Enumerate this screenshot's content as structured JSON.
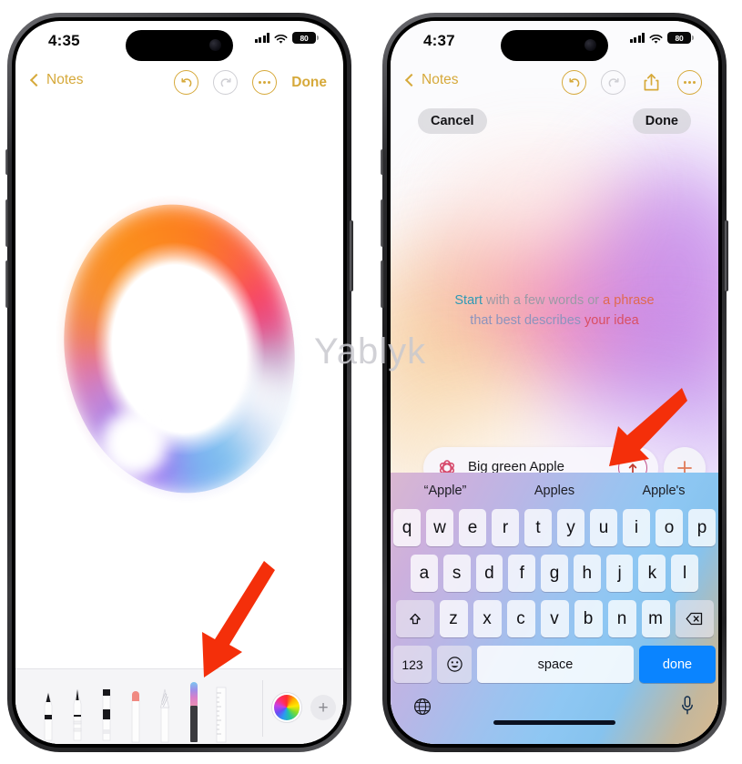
{
  "watermark": "Yablyk",
  "phones": {
    "left": {
      "status": {
        "time": "4:35",
        "battery": "80",
        "signal_icon": "cellular-bars-icon",
        "wifi_icon": "wifi-icon"
      },
      "nav": {
        "back_label": "Notes",
        "back_icon": "chevron-left-icon",
        "undo_icon": "undo-icon",
        "redo_icon": "redo-icon",
        "more_icon": "ellipsis-circle-icon",
        "done_label": "Done"
      },
      "canvas": {
        "drawing": "rainbow-circle-sketch"
      },
      "palette": {
        "tools": [
          {
            "name": "pen-tool",
            "label": "Pen"
          },
          {
            "name": "fountain-pen-tool",
            "label": "Fountain pen"
          },
          {
            "name": "marker-tool",
            "label": "Marker"
          },
          {
            "name": "pencil-tool",
            "label": "Pencil"
          },
          {
            "name": "brush-tool",
            "label": "Brush"
          },
          {
            "name": "image-wand-tool",
            "label": "Image Wand"
          },
          {
            "name": "ruler-tool",
            "label": "Ruler"
          }
        ],
        "color_wheel": "color-wheel-icon",
        "add_label": "+"
      }
    },
    "right": {
      "status": {
        "time": "4:37",
        "battery": "80",
        "signal_icon": "cellular-bars-icon",
        "wifi_icon": "wifi-icon"
      },
      "nav": {
        "back_label": "Notes",
        "back_icon": "chevron-left-icon",
        "undo_icon": "undo-icon",
        "redo_icon": "redo-icon",
        "share_icon": "share-icon",
        "more_icon": "ellipsis-circle-icon"
      },
      "sheet": {
        "cancel_label": "Cancel",
        "done_label": "Done",
        "prompt_line1": [
          {
            "text": "Start",
            "color": "#2f9ab5"
          },
          {
            "text": " with a few words or ",
            "color": "#9b9aa6"
          },
          {
            "text": "a phrase",
            "color": "#e0694f"
          }
        ],
        "prompt_line2": [
          {
            "text": "that best describes ",
            "color": "#8c93bd"
          },
          {
            "text": "your idea",
            "color": "#d94f63"
          }
        ]
      },
      "input": {
        "icon": "image-playground-flower-icon",
        "value": "Big green Apple",
        "submit_icon": "arrow-up-circle-icon",
        "add_icon": "plus-icon"
      },
      "keyboard": {
        "suggestions": [
          "“Apple”",
          "Apples",
          "Apple's"
        ],
        "row1": [
          "q",
          "w",
          "e",
          "r",
          "t",
          "y",
          "u",
          "i",
          "o",
          "p"
        ],
        "row2": [
          "a",
          "s",
          "d",
          "f",
          "g",
          "h",
          "j",
          "k",
          "l"
        ],
        "row3": [
          "z",
          "x",
          "c",
          "v",
          "b",
          "n",
          "m"
        ],
        "shift_icon": "shift-icon",
        "backspace_icon": "backspace-icon",
        "numbers_label": "123",
        "emoji_icon": "emoji-icon",
        "space_label": "space",
        "return_label": "done",
        "globe_icon": "globe-icon",
        "mic_icon": "microphone-icon"
      }
    }
  },
  "annotations": {
    "arrow_left": "red-arrow-pointing-to-image-wand-tool",
    "arrow_right": "red-arrow-pointing-to-submit-button"
  }
}
